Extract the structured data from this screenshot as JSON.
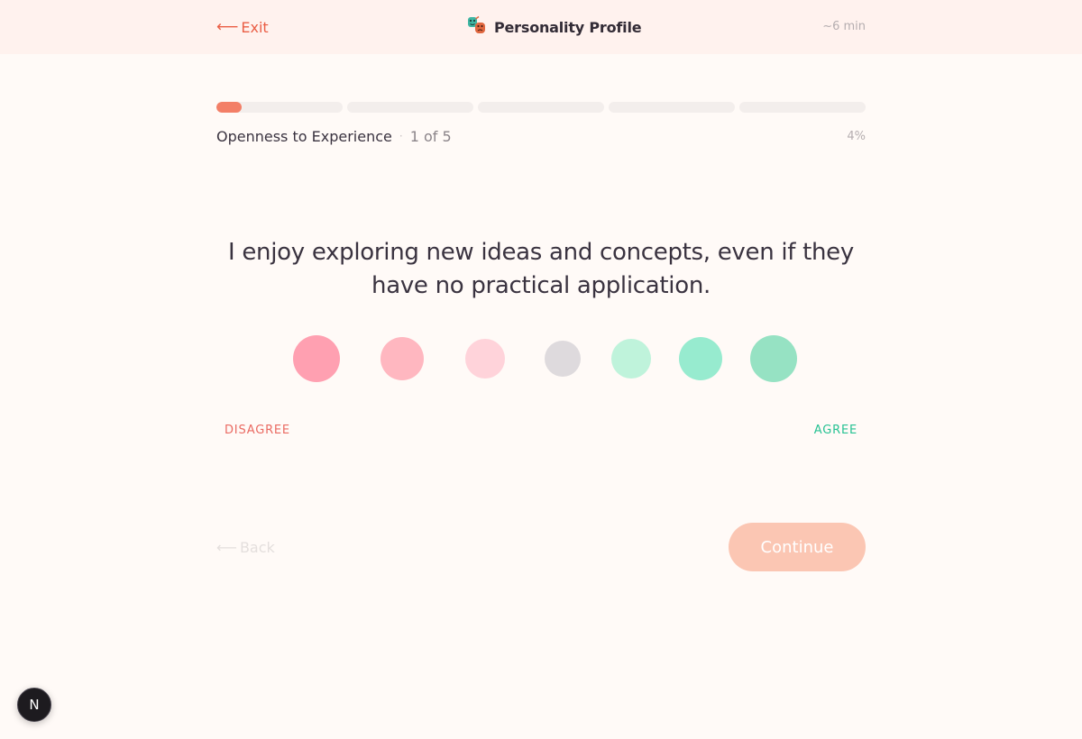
{
  "header": {
    "exit_arrow": "⟵",
    "exit_label": "Exit",
    "brand_icon": "theater-masks-icon",
    "brand_title": "Personality Profile",
    "duration": "~6 min"
  },
  "progress": {
    "segments_total": 5,
    "current_segment": 1,
    "percent_value": 4,
    "segment_fill_fraction": 0.2,
    "fill_color": "#f37f67",
    "track_color": "#f3eeec"
  },
  "section": {
    "name": "Openness to Experience",
    "separator": "·",
    "count": "1 of 5",
    "percent": "4%"
  },
  "question": {
    "text": "I enjoy exploring new ideas and concepts, even if they have no practical application."
  },
  "scale": {
    "options": [
      {
        "id": "strongly-disagree",
        "color": "#ffa0b1"
      },
      {
        "id": "disagree",
        "color": "#ffb7c0"
      },
      {
        "id": "slightly-disagree",
        "color": "#ffd3da"
      },
      {
        "id": "neutral",
        "color": "#dedadd"
      },
      {
        "id": "slightly-agree",
        "color": "#bff3db"
      },
      {
        "id": "agree",
        "color": "#97ebcf"
      },
      {
        "id": "strongly-agree",
        "color": "#96e2c3"
      }
    ],
    "label_left": "DISAGREE",
    "label_right": "AGREE",
    "label_left_color": "#ea6a62",
    "label_right_color": "#27c293"
  },
  "footer": {
    "back_arrow": "⟵",
    "back_label": "Back",
    "continue_label": "Continue",
    "continue_color": "#fbc6b3"
  },
  "dev_badge": {
    "letter": "N"
  }
}
